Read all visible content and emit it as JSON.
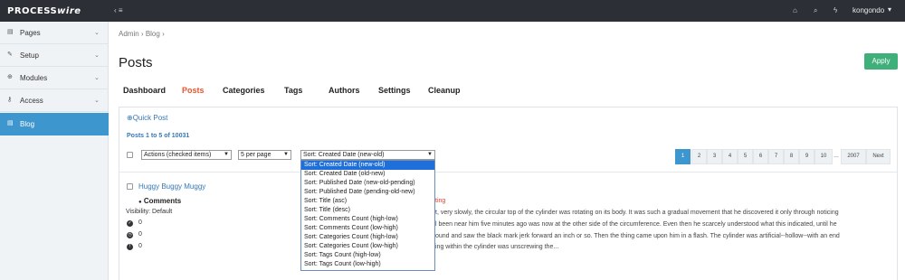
{
  "topbar": {
    "logo_main": "PROCESS",
    "logo_italic": "wire",
    "menu_toggle": "‹ ≡",
    "icons": [
      "home-icon",
      "search-icon",
      "bolt-icon"
    ],
    "user": "kongondo"
  },
  "sidebar": {
    "items": [
      {
        "label": "Pages",
        "icon": "file-icon"
      },
      {
        "label": "Setup",
        "icon": "wrench-icon"
      },
      {
        "label": "Modules",
        "icon": "plug-icon"
      },
      {
        "label": "Access",
        "icon": "key-icon"
      },
      {
        "label": "Blog",
        "icon": "file-icon"
      }
    ]
  },
  "breadcrumb": {
    "items": [
      "Admin",
      "Blog"
    ]
  },
  "page_title": "Posts",
  "apply_label": "Apply",
  "tabs": [
    "Dashboard",
    "Posts",
    "Categories",
    "Tags",
    "Authors",
    "Settings",
    "Cleanup"
  ],
  "quick_post": "Quick Post",
  "posts_count": "Posts 1 to 5 of 10031",
  "actions_select": "Actions (checked items)",
  "per_page_select": "5 per page",
  "sort_select": "Sort: Created Date (new-old)",
  "sort_options": [
    "Sort: Created Date (new-old)",
    "Sort: Created Date (old-new)",
    "Sort: Published Date (new-old-pending)",
    "Sort: Published Date (pending-old-new)",
    "Sort: Title (asc)",
    "Sort: Title (desc)",
    "Sort: Comments Count (high-low)",
    "Sort: Comments Count (low-high)",
    "Sort: Categories Count (high-low)",
    "Sort: Categories Count (low-high)",
    "Sort: Tags Count (high-low)",
    "Sort: Tags Count (low-high)"
  ],
  "pagination": [
    "1",
    "2",
    "3",
    "4",
    "5",
    "6",
    "7",
    "8",
    "9",
    "10",
    "…",
    "2007",
    "Next"
  ],
  "post": {
    "title": "Huggy Buggy Muggy",
    "comments_header": "Comments",
    "visibility": "Visibility: Default",
    "stats": [
      "0",
      "0",
      "0"
    ],
    "status_text": "ting",
    "body_lines": [
      "t, very slowly, the circular top of the cylinder was rotating on its body. It was such a gradual movement that he discovered it only through noticing",
      "l been near him five minutes ago was now at the other side of the circumference. Even then he scarcely understood what this indicated, until he",
      "ound and saw the black mark jerk forward an inch or so. Then the thing came upon him in a flash. The cylinder was artificial--hollow--with an end",
      "ing within the cylinder was unscrewing the..."
    ]
  }
}
